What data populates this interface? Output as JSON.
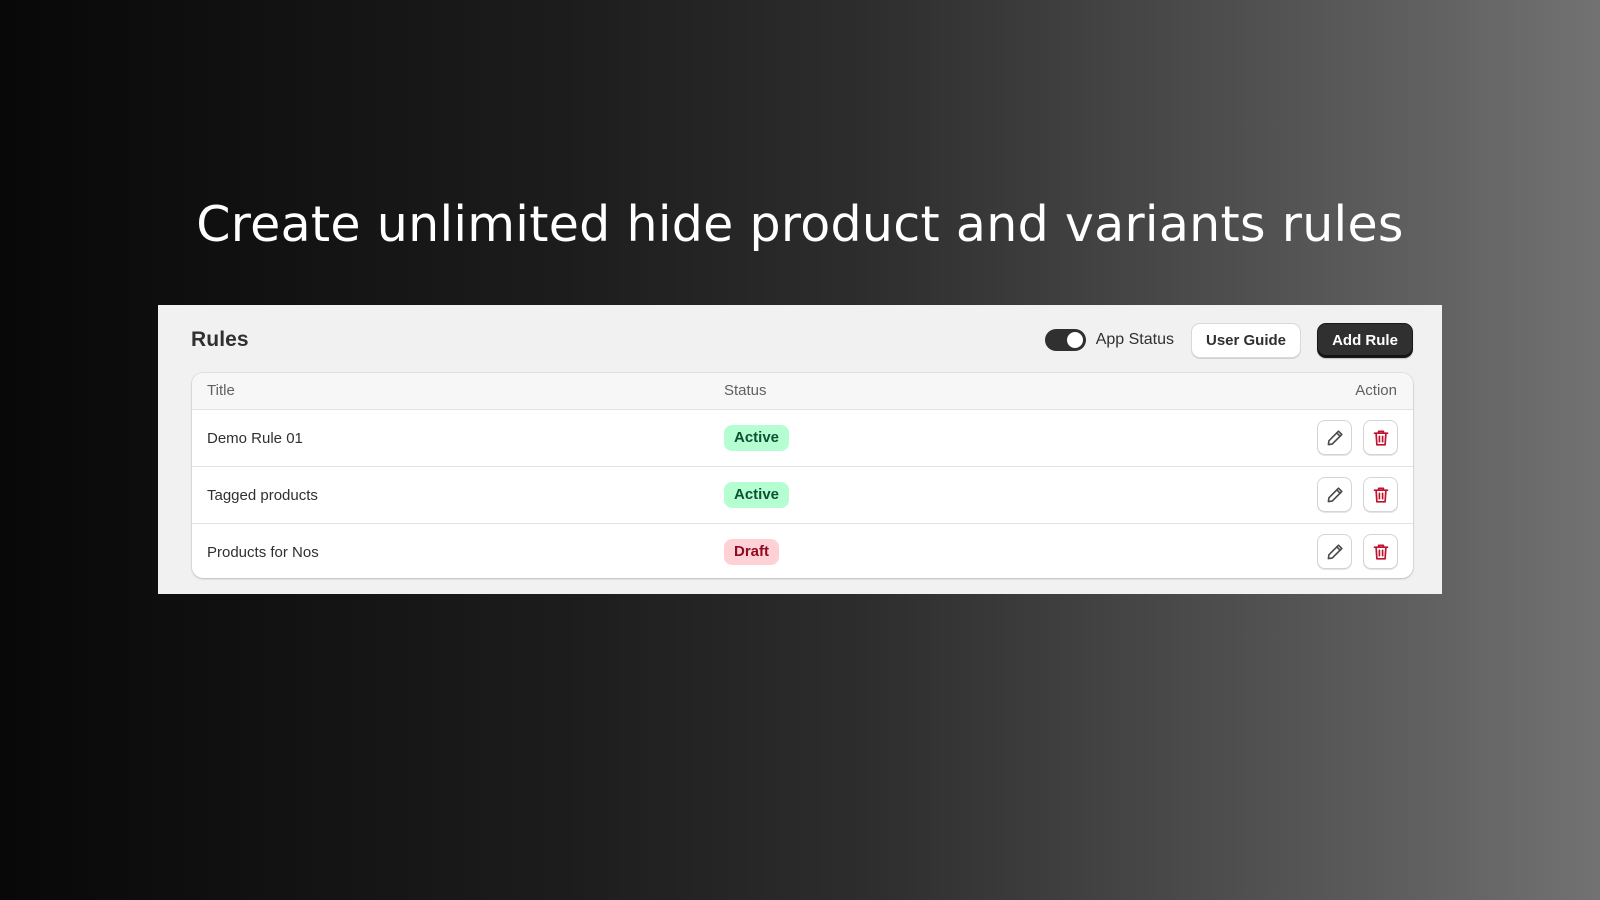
{
  "headline": "Create unlimited hide product and variants rules",
  "panel": {
    "title": "Rules",
    "app_status": {
      "label": "App Status",
      "enabled": true
    },
    "buttons": {
      "user_guide": "User Guide",
      "add_rule": "Add Rule"
    }
  },
  "table": {
    "columns": {
      "title": "Title",
      "status": "Status",
      "action": "Action"
    },
    "rows": [
      {
        "title": "Demo Rule 01",
        "status": "Active"
      },
      {
        "title": "Tagged products",
        "status": "Active"
      },
      {
        "title": "Products for Nos",
        "status": "Draft"
      }
    ],
    "row_actions": [
      "pencil-icon",
      "trash-icon"
    ]
  },
  "colors": {
    "active_badge_bg": "#b4fed2",
    "active_badge_text": "#0c5132",
    "draft_badge_bg": "#fed1d7",
    "draft_badge_text": "#8e0b21",
    "primary_button": "#303030",
    "delete_icon": "#c0132e"
  }
}
